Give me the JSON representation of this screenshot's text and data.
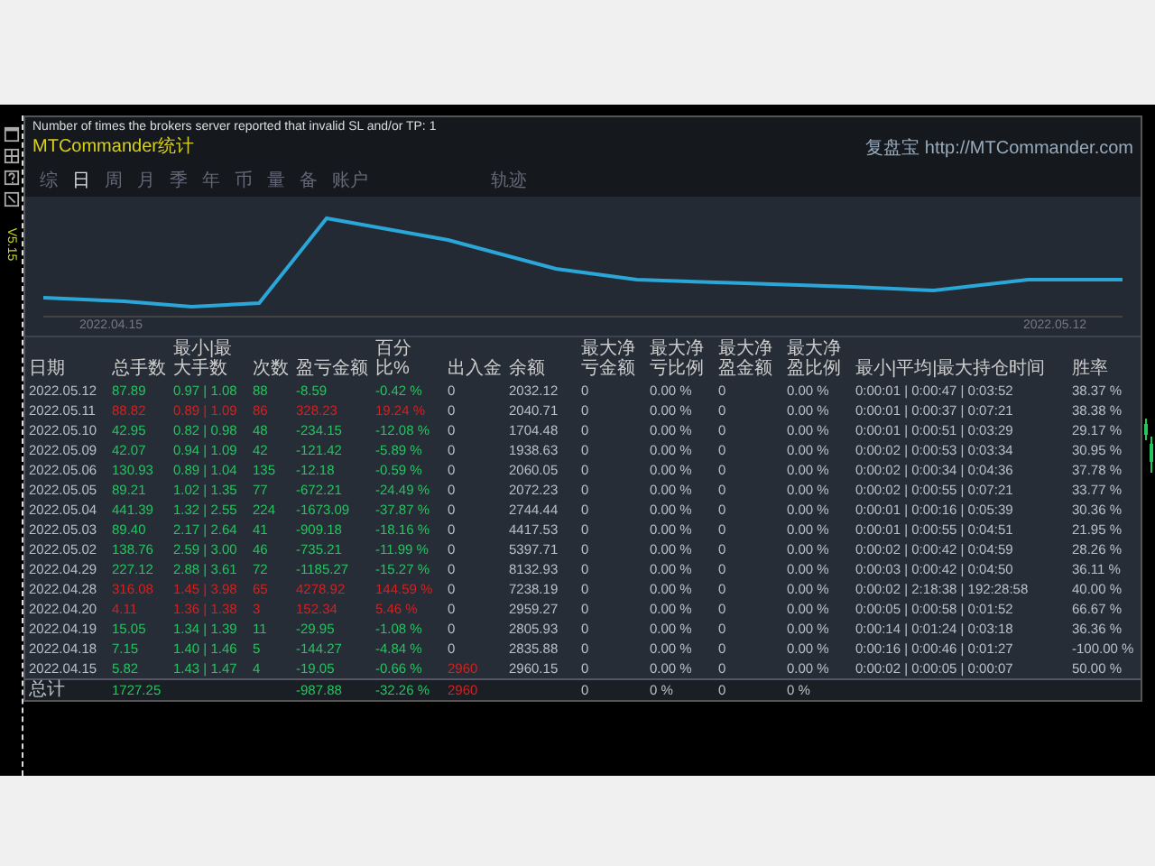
{
  "message": "Number of times the brokers server reported that invalid SL and/or TP: 1",
  "title": "MTCommander统计",
  "version": "V5.15",
  "link": "复盘宝 http://MTCommander.com",
  "tabs": [
    {
      "label": "综",
      "selected": false
    },
    {
      "label": "日",
      "selected": true
    },
    {
      "label": "周",
      "selected": false
    },
    {
      "label": "月",
      "selected": false
    },
    {
      "label": "季",
      "selected": false
    },
    {
      "label": "年",
      "selected": false
    },
    {
      "label": "币",
      "selected": false
    },
    {
      "label": "量",
      "selected": false
    },
    {
      "label": "备",
      "selected": false
    },
    {
      "label": "账户",
      "selected": false
    },
    {
      "label": "轨迹",
      "selected": false
    }
  ],
  "chart": {
    "start_label": "2022.04.15",
    "end_label": "2022.05.12"
  },
  "table": {
    "columns": [
      "日期",
      "总手数",
      "最小|最大手数",
      "次数",
      "盈亏金额",
      "百分比%",
      "出入金",
      "余额",
      "最大净亏金额",
      "最大净亏比例",
      "最大净盈金额",
      "最大净盈比例",
      "最小|平均|最大持仓时间",
      "胜率"
    ],
    "rows": [
      {
        "color": "#22c55e",
        "deposit_flag": false,
        "cells": [
          "2022.05.12",
          "87.89",
          "0.97 | 1.08",
          "88",
          "-8.59",
          "-0.42 %",
          "0",
          "2032.12",
          "0",
          "0.00 %",
          "0",
          "0.00 %",
          "0:00:01 | 0:00:47 | 0:03:52",
          "38.37 %"
        ]
      },
      {
        "color": "#d62020",
        "deposit_flag": false,
        "cells": [
          "2022.05.11",
          "88.82",
          "0.89 | 1.09",
          "86",
          "328.23",
          "19.24 %",
          "0",
          "2040.71",
          "0",
          "0.00 %",
          "0",
          "0.00 %",
          "0:00:01 | 0:00:37 | 0:07:21",
          "38.38 %"
        ]
      },
      {
        "color": "#22c55e",
        "deposit_flag": false,
        "cells": [
          "2022.05.10",
          "42.95",
          "0.82 | 0.98",
          "48",
          "-234.15",
          "-12.08 %",
          "0",
          "1704.48",
          "0",
          "0.00 %",
          "0",
          "0.00 %",
          "0:00:01 | 0:00:51 | 0:03:29",
          "29.17 %"
        ]
      },
      {
        "color": "#22c55e",
        "deposit_flag": false,
        "cells": [
          "2022.05.09",
          "42.07",
          "0.94 | 1.09",
          "42",
          "-121.42",
          "-5.89 %",
          "0",
          "1938.63",
          "0",
          "0.00 %",
          "0",
          "0.00 %",
          "0:00:02 | 0:00:53 | 0:03:34",
          "30.95 %"
        ]
      },
      {
        "color": "#22c55e",
        "deposit_flag": false,
        "cells": [
          "2022.05.06",
          "130.93",
          "0.89 | 1.04",
          "135",
          "-12.18",
          "-0.59 %",
          "0",
          "2060.05",
          "0",
          "0.00 %",
          "0",
          "0.00 %",
          "0:00:02 | 0:00:34 | 0:04:36",
          "37.78 %"
        ]
      },
      {
        "color": "#22c55e",
        "deposit_flag": false,
        "cells": [
          "2022.05.05",
          "89.21",
          "1.02 | 1.35",
          "77",
          "-672.21",
          "-24.49 %",
          "0",
          "2072.23",
          "0",
          "0.00 %",
          "0",
          "0.00 %",
          "0:00:02 | 0:00:55 | 0:07:21",
          "33.77 %"
        ]
      },
      {
        "color": "#22c55e",
        "deposit_flag": false,
        "cells": [
          "2022.05.04",
          "441.39",
          "1.32 | 2.55",
          "224",
          "-1673.09",
          "-37.87 %",
          "0",
          "2744.44",
          "0",
          "0.00 %",
          "0",
          "0.00 %",
          "0:00:01 | 0:00:16 | 0:05:39",
          "30.36 %"
        ]
      },
      {
        "color": "#22c55e",
        "deposit_flag": false,
        "cells": [
          "2022.05.03",
          "89.40",
          "2.17 | 2.64",
          "41",
          "-909.18",
          "-18.16 %",
          "0",
          "4417.53",
          "0",
          "0.00 %",
          "0",
          "0.00 %",
          "0:00:01 | 0:00:55 | 0:04:51",
          "21.95 %"
        ]
      },
      {
        "color": "#22c55e",
        "deposit_flag": false,
        "cells": [
          "2022.05.02",
          "138.76",
          "2.59 | 3.00",
          "46",
          "-735.21",
          "-11.99 %",
          "0",
          "5397.71",
          "0",
          "0.00 %",
          "0",
          "0.00 %",
          "0:00:02 | 0:00:42 | 0:04:59",
          "28.26 %"
        ]
      },
      {
        "color": "#22c55e",
        "deposit_flag": false,
        "cells": [
          "2022.04.29",
          "227.12",
          "2.88 | 3.61",
          "72",
          "-1185.27",
          "-15.27 %",
          "0",
          "8132.93",
          "0",
          "0.00 %",
          "0",
          "0.00 %",
          "0:00:03 | 0:00:42 | 0:04:50",
          "36.11 %"
        ]
      },
      {
        "color": "#d62020",
        "deposit_flag": false,
        "cells": [
          "2022.04.28",
          "316.08",
          "1.45 | 3.98",
          "65",
          "4278.92",
          "144.59 %",
          "0",
          "7238.19",
          "0",
          "0.00 %",
          "0",
          "0.00 %",
          "0:00:02 | 2:18:38 | 192:28:58",
          "40.00 %"
        ]
      },
      {
        "color": "#d62020",
        "deposit_flag": false,
        "cells": [
          "2022.04.20",
          "4.11",
          "1.36 | 1.38",
          "3",
          "152.34",
          "5.46 %",
          "0",
          "2959.27",
          "0",
          "0.00 %",
          "0",
          "0.00 %",
          "0:00:05 | 0:00:58 | 0:01:52",
          "66.67 %"
        ]
      },
      {
        "color": "#22c55e",
        "deposit_flag": false,
        "cells": [
          "2022.04.19",
          "15.05",
          "1.34 | 1.39",
          "11",
          "-29.95",
          "-1.08 %",
          "0",
          "2805.93",
          "0",
          "0.00 %",
          "0",
          "0.00 %",
          "0:00:14 | 0:01:24 | 0:03:18",
          "36.36 %"
        ]
      },
      {
        "color": "#22c55e",
        "deposit_flag": false,
        "cells": [
          "2022.04.18",
          "7.15",
          "1.40 | 1.46",
          "5",
          "-144.27",
          "-4.84 %",
          "0",
          "2835.88",
          "0",
          "0.00 %",
          "0",
          "0.00 %",
          "0:00:16 | 0:00:46 | 0:01:27",
          "-100.00 %"
        ]
      },
      {
        "color": "#22c55e",
        "deposit_flag": true,
        "cells": [
          "2022.04.15",
          "5.82",
          "1.43 | 1.47",
          "4",
          "-19.05",
          "-0.66 %",
          "2960",
          "2960.15",
          "0",
          "0.00 %",
          "0",
          "0.00 %",
          "0:00:02 | 0:00:05 | 0:00:07",
          "50.00 %"
        ]
      }
    ],
    "total": {
      "label": "总计",
      "total_lots": "1727.25",
      "profit": "-987.88",
      "percent": "-32.26 %",
      "deposit": "2960",
      "max_loss_amount": "0",
      "max_loss_ratio": "0 %",
      "max_gain_amount": "0",
      "max_gain_ratio": "0 %"
    }
  }
}
